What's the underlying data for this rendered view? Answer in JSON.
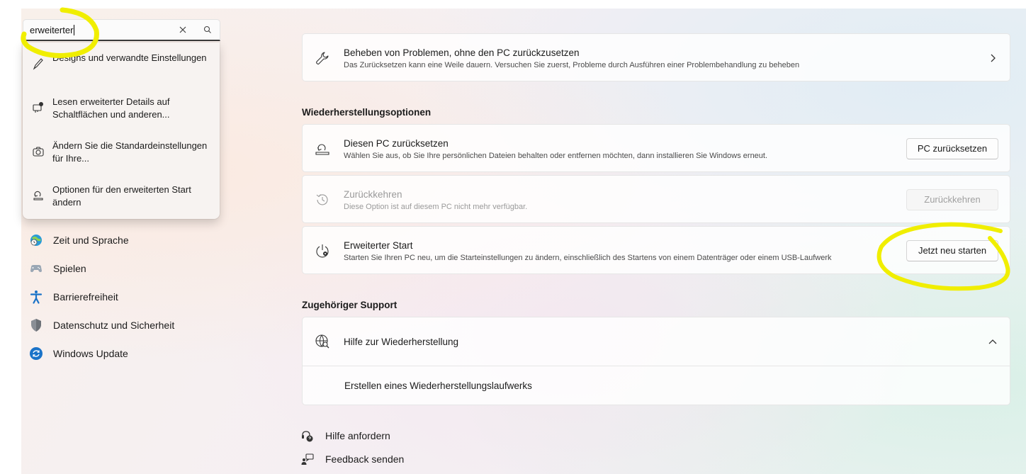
{
  "search": {
    "value": "erweiterter"
  },
  "suggestions": [
    {
      "label": "Designs und verwandte Einstellungen",
      "icon": "brush-icon"
    },
    {
      "label": "Lesen erweiterter Details auf Schaltflächen und anderen...",
      "icon": "narrator-icon"
    },
    {
      "label": "Ändern Sie die Standardeinstellungen für Ihre...",
      "icon": "camera-icon"
    },
    {
      "label": "Optionen für den erweiterten Start ändern",
      "icon": "reset-pc-icon"
    }
  ],
  "sidebar": {
    "items": [
      {
        "label": "Zeit und Sprache",
        "icon": "globe-clock-icon"
      },
      {
        "label": "Spielen",
        "icon": "gamepad-icon"
      },
      {
        "label": "Barrierefreiheit",
        "icon": "accessibility-icon"
      },
      {
        "label": "Datenschutz und Sicherheit",
        "icon": "shield-icon"
      },
      {
        "label": "Windows Update",
        "icon": "windows-update-icon"
      }
    ]
  },
  "main": {
    "troubleshoot": {
      "title": "Beheben von Problemen, ohne den PC zurückzusetzen",
      "desc": "Das Zurücksetzen kann eine Weile dauern. Versuchen Sie zuerst, Probleme durch Ausführen einer Problembehandlung zu beheben"
    },
    "recovery_section_title": "Wiederherstellungsoptionen",
    "reset_pc": {
      "title": "Diesen PC zurücksetzen",
      "desc": "Wählen Sie aus, ob Sie Ihre persönlichen Dateien behalten oder entfernen möchten, dann installieren Sie Windows erneut.",
      "button": "PC zurücksetzen"
    },
    "go_back": {
      "title": "Zurückkehren",
      "desc": "Diese Option ist auf diesem PC nicht mehr verfügbar.",
      "button": "Zurückkehren"
    },
    "advanced_start": {
      "title": "Erweiterter Start",
      "desc": "Starten Sie Ihren PC neu, um die Starteinstellungen zu ändern, einschließlich des Startens von einem Datenträger oder einem USB-Laufwerk",
      "button": "Jetzt neu starten"
    },
    "support_section_title": "Zugehöriger Support",
    "recovery_help": {
      "title": "Hilfe zur Wiederherstellung",
      "link": "Erstellen eines Wiederherstellungslaufwerks"
    },
    "footer": {
      "help": "Hilfe anfordern",
      "feedback": "Feedback senden"
    }
  },
  "colors": {
    "annotation": "#f2f000",
    "accent": "#0067c0"
  }
}
